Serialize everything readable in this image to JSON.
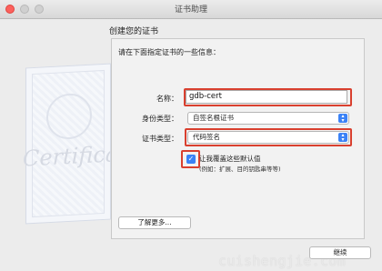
{
  "window": {
    "title": "证书助理"
  },
  "heading": "创建您的证书",
  "intro": "请在下面指定证书的一些信息：",
  "name": {
    "label": "名称：",
    "value": "gdb-cert"
  },
  "identity_type": {
    "label": "身份类型：",
    "selected": "自签名根证书"
  },
  "cert_type": {
    "label": "证书类型：",
    "selected": "代码签名"
  },
  "override": {
    "checked": true,
    "label": "让我覆盖这些默认值",
    "sublabel": "(例如：扩展、目的钥匙串等等)"
  },
  "learn_more_label": "了解更多...",
  "continue_label": "继续",
  "watermark": "cuishengjie.com",
  "colors": {
    "highlight": "#d9402f",
    "accent": "#3b82f6"
  }
}
